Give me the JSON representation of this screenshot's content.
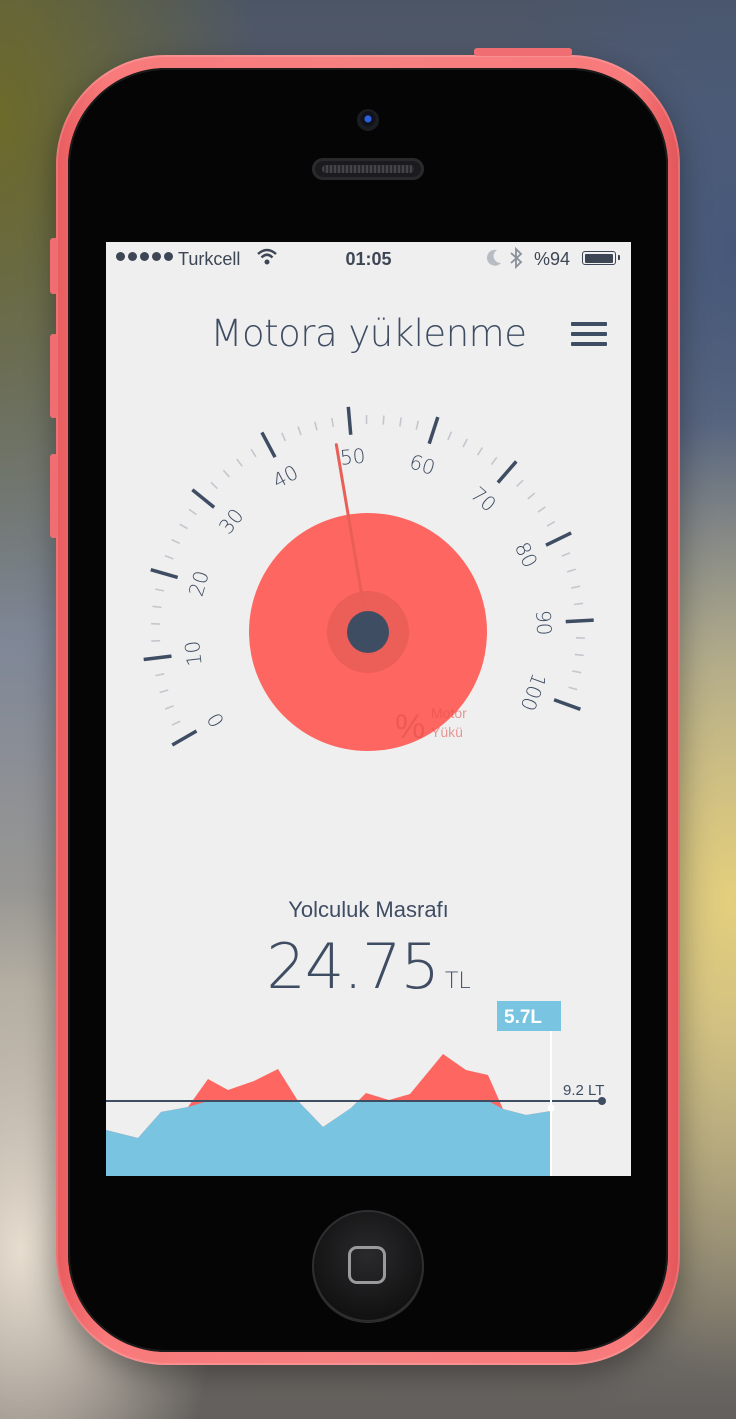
{
  "status_bar": {
    "carrier": "Turkcell",
    "time": "01:05",
    "battery": "%94"
  },
  "header": {
    "title": "Motora yüklenme"
  },
  "gauge": {
    "ticks": [
      "0",
      "10",
      "20",
      "30",
      "40",
      "50",
      "60",
      "70",
      "80",
      "90",
      "100"
    ],
    "min": 0,
    "max": 100,
    "needle_value": 48,
    "center_label_symbol": "%",
    "center_label_line1": "Motor",
    "center_label_line2": "Yükü",
    "colors": {
      "dial": "#fe6761",
      "hub": "#3f4d63",
      "ticks": "#3f4d63",
      "needle": "#e95f58"
    }
  },
  "trip": {
    "label": "Yolculuk Masrafı",
    "value": "24.75",
    "unit": "TL"
  },
  "consumption_chart": {
    "current_label": "5.7L",
    "reference_label": "9.2 LT",
    "colors": {
      "area_blue": "#79c4e0",
      "area_red": "#fe6761",
      "line": "#3f4d63",
      "badge": "#79c4e0"
    }
  }
}
